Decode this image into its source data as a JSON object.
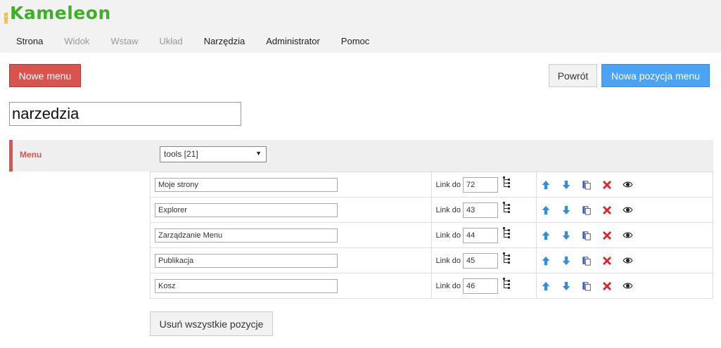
{
  "app": {
    "logo_small": "WEB",
    "logo_main": "Kameleon"
  },
  "menubar": [
    {
      "label": "Strona",
      "disabled": false
    },
    {
      "label": "Widok",
      "disabled": true
    },
    {
      "label": "Wstaw",
      "disabled": true
    },
    {
      "label": "Układ",
      "disabled": true
    },
    {
      "label": "Narzędzia",
      "disabled": false
    },
    {
      "label": "Administrator",
      "disabled": false
    },
    {
      "label": "Pomoc",
      "disabled": false
    }
  ],
  "toolbar": {
    "new_menu": "Nowe menu",
    "back": "Powrót",
    "new_item": "Nowa pozycja menu"
  },
  "menu_name": "narzedzia",
  "menu_select": {
    "label": "Menu",
    "selected": "tools [21]"
  },
  "items": [
    {
      "name": "Moje strony",
      "link_label": "Link do",
      "link": "72"
    },
    {
      "name": "Explorer",
      "link_label": "Link do",
      "link": "43"
    },
    {
      "name": "Zarządzanie Menu",
      "link_label": "Link do",
      "link": "44"
    },
    {
      "name": "Publikacja",
      "link_label": "Link do",
      "link": "45"
    },
    {
      "name": "Kosz",
      "link_label": "Link do",
      "link": "46"
    }
  ],
  "remove_all": "Usuń wszystkie pozycje",
  "icons": [
    "tree-icon",
    "arrow-up-icon",
    "arrow-down-icon",
    "copy-icon",
    "delete-icon",
    "eye-icon"
  ],
  "colors": {
    "red": "#d9534f",
    "blue": "#4aa3f5",
    "logo_green": "#3fae2a"
  }
}
